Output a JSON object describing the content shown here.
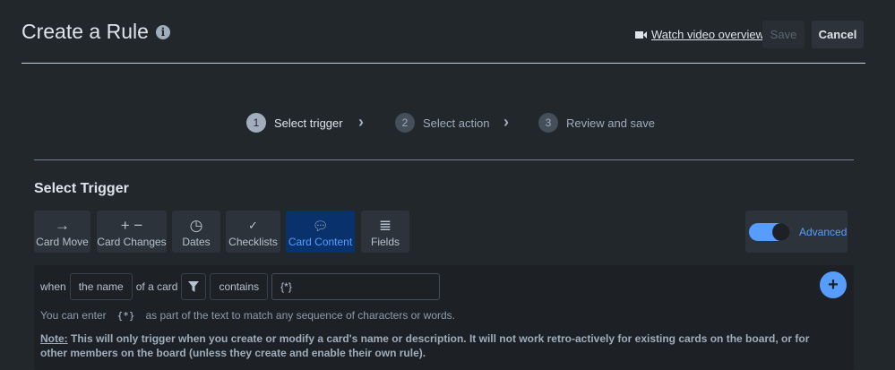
{
  "header": {
    "title": "Create a Rule",
    "video_link": "Watch video overview",
    "save": "Save",
    "cancel": "Cancel"
  },
  "steps": [
    {
      "num": "1",
      "label": "Select trigger"
    },
    {
      "num": "2",
      "label": "Select action"
    },
    {
      "num": "3",
      "label": "Review and save"
    }
  ],
  "section_title": "Select Trigger",
  "trigger_types": [
    {
      "label": "Card Move",
      "icon": "arrow-right-icon"
    },
    {
      "label": "Card Changes",
      "icon": "plus-minus-icon"
    },
    {
      "label": "Dates",
      "icon": "clock-icon"
    },
    {
      "label": "Checklists",
      "icon": "check-icon"
    },
    {
      "label": "Card Content",
      "icon": "speech-bubble-icon"
    },
    {
      "label": "Fields",
      "icon": "lines-icon"
    }
  ],
  "advanced": {
    "label": "Advanced",
    "enabled": true
  },
  "trigger": {
    "when": "when",
    "field": "the name",
    "of_card": "of a card",
    "operator": "contains",
    "value": "{*}"
  },
  "hint": {
    "before": "You can enter",
    "code": "{*}",
    "after": "as part of the text to match any sequence of characters or words."
  },
  "note": {
    "label": "Note:",
    "text": "This will only trigger when you create or modify a card's name or description. It will not work retro-actively for existing cards on the board, or for other members on the board (unless they create and enable their own rule)."
  },
  "colors": {
    "accent": "#579dff",
    "active_bg": "#09326c",
    "bg": "#22272b"
  }
}
